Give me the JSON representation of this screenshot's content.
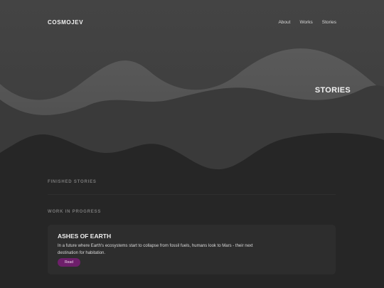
{
  "brand": {
    "logo": "COSMOJEV"
  },
  "nav": {
    "items": [
      "About",
      "Works",
      "Stories"
    ]
  },
  "hero": {
    "title": "STORIES"
  },
  "sections": {
    "finished": "FINISHED STORIES",
    "in_progress": "WORK IN PROGRESS"
  },
  "card": {
    "title": "ASHES OF EARTH",
    "description": "In a future where Earth's ecosystems start to collapse from fossil fuels, humans look to Mars - their next destination for habitation.",
    "button": "Read"
  },
  "colors": {
    "background": "#262626",
    "accent": "#6e1f6b"
  }
}
